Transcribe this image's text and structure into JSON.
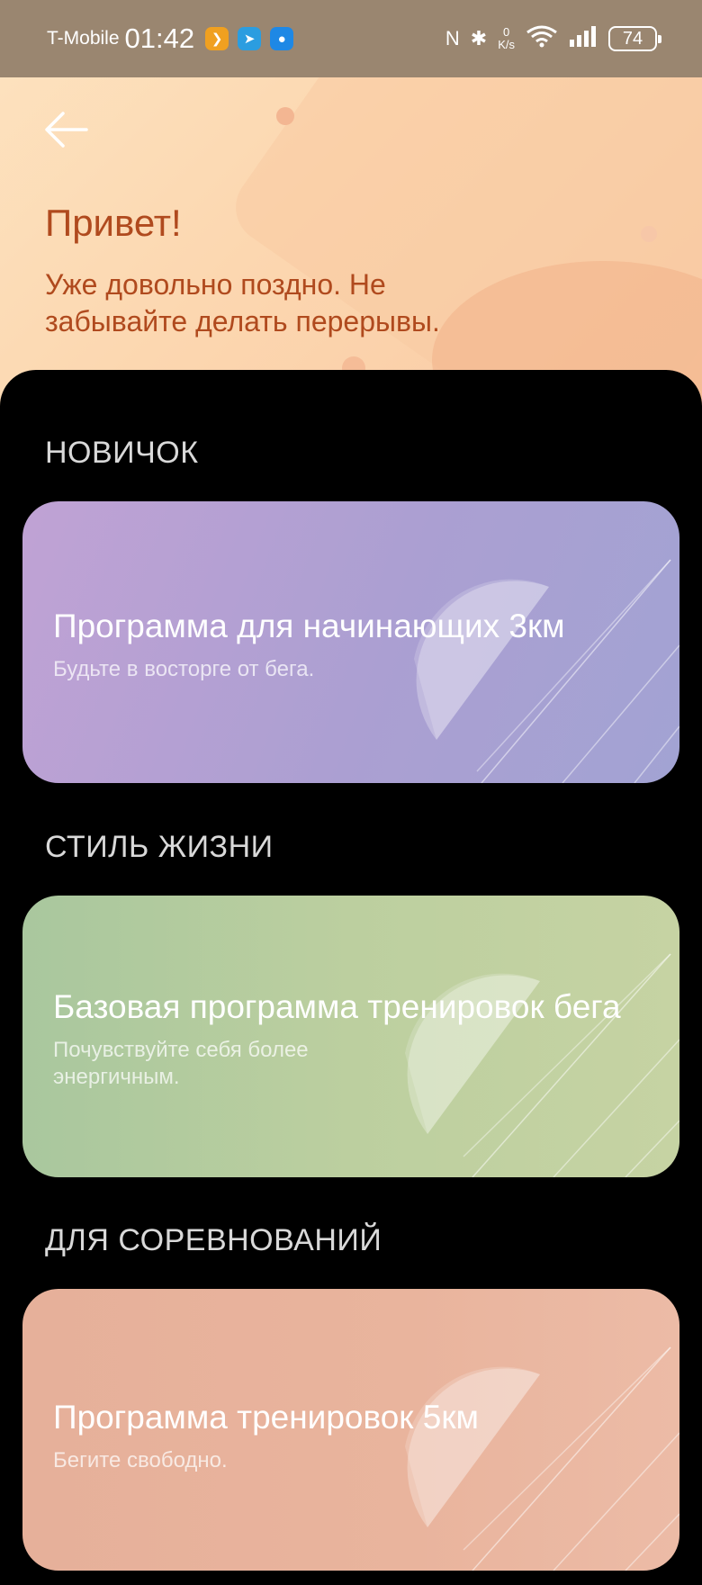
{
  "status_bar": {
    "carrier": "T-Mobile",
    "time": "01:42",
    "net_speed_value": "0",
    "net_speed_unit": "K/s",
    "battery": "74"
  },
  "header": {
    "greeting": "Привет!",
    "subtitle": "Уже довольно поздно. Не забывайте делать перерывы."
  },
  "sections": [
    {
      "title": "НОВИЧОК",
      "card": {
        "title": "Программа для начинающих 3км",
        "subtitle": "Будьте в восторге от бега."
      }
    },
    {
      "title": "СТИЛЬ ЖИЗНИ",
      "card": {
        "title": "Базовая программа тренировок бега",
        "subtitle": "Почувствуйте себя более энергичным."
      }
    },
    {
      "title": "ДЛЯ СОРЕВНОВАНИЙ",
      "card": {
        "title": "Программа тренировок 5км",
        "subtitle": "Бегите свободно."
      }
    }
  ],
  "colors": {
    "header_text": "#b04a1e",
    "beginner_card": "#b39fd3",
    "lifestyle_card": "#b8cc9f",
    "competition_card": "#e8b39c"
  }
}
